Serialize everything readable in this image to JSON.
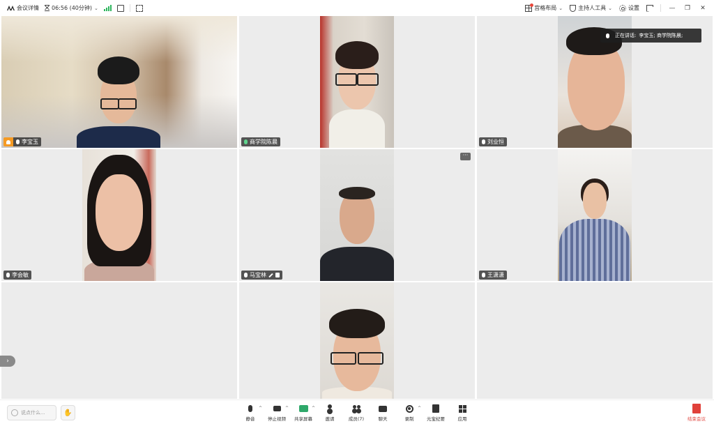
{
  "topbar": {
    "meeting_details": "会议详情",
    "timer": "06:56 (40分钟)",
    "grid_layout": "宫格布局",
    "host_tools": "主持人工具",
    "settings": "设置"
  },
  "speaking_indicator": {
    "prefix": "正在讲话:",
    "speakers": "李宝玉; 商学院陈晨;"
  },
  "participants": [
    {
      "name": "李宝玉",
      "is_host": true,
      "active_speaker": true,
      "mic": "on"
    },
    {
      "name": "商学院陈晨",
      "is_host": false,
      "active_speaker": false,
      "mic": "speaking"
    },
    {
      "name": "刘业恒",
      "is_host": false,
      "active_speaker": false,
      "mic": "on"
    },
    {
      "name": "李会敏",
      "is_host": false,
      "active_speaker": false,
      "mic": "on"
    },
    {
      "name": "马宝林",
      "is_host": false,
      "active_speaker": false,
      "mic": "on"
    },
    {
      "name": "王潇潇",
      "is_host": false,
      "active_speaker": false,
      "mic": "on"
    },
    {
      "name": "",
      "is_host": false,
      "active_speaker": false,
      "mic": ""
    }
  ],
  "more_button": "···",
  "side_toggle": "›",
  "chat": {
    "placeholder": "说点什么..."
  },
  "toolbar": [
    {
      "label": "静音",
      "icon": "microphone-icon",
      "has_caret": true
    },
    {
      "label": "停止视频",
      "icon": "camera-icon",
      "has_caret": true
    },
    {
      "label": "共享屏幕",
      "icon": "share-screen-icon",
      "has_caret": true
    },
    {
      "label": "邀请",
      "icon": "invite-user-icon",
      "has_caret": false
    },
    {
      "label": "成员(7)",
      "icon": "members-icon",
      "has_caret": false
    },
    {
      "label": "聊天",
      "icon": "chat-icon",
      "has_caret": false
    },
    {
      "label": "录制",
      "icon": "record-icon",
      "has_caret": true
    },
    {
      "label": "元宝纪要",
      "icon": "notes-icon",
      "has_caret": false
    },
    {
      "label": "应用",
      "icon": "apps-icon",
      "has_caret": false
    }
  ],
  "end_meeting": "结束会议",
  "colors": {
    "active_border": "#3ec28f",
    "host_badge": "#f59a23",
    "end_meeting": "#e0413a",
    "signal": "#2db55d"
  }
}
